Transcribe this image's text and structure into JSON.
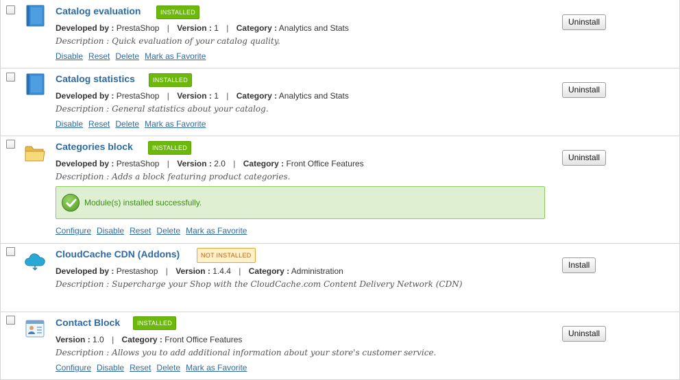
{
  "labels": {
    "developed_by": "Developed by :",
    "version": "Version :",
    "category": "Category :",
    "description": "Description :"
  },
  "colors": {
    "title": "#2d6aa3",
    "installed_badge": "#6cb80b",
    "not_installed_badge_bg": "#fff0c6",
    "not_installed_badge_text": "#c55f0f",
    "success_bg": "#dff0d2"
  },
  "modules": [
    {
      "name": "Catalog evaluation",
      "icon": "book-icon",
      "status": "INSTALLED",
      "developer": "PrestaShop",
      "version": "1",
      "category": "Analytics and Stats",
      "description": "Quick evaluation of your catalog quality.",
      "action": "Uninstall",
      "links": [
        "Disable",
        "Reset",
        "Delete",
        "Mark as Favorite"
      ]
    },
    {
      "name": "Catalog statistics",
      "icon": "book-icon",
      "status": "INSTALLED",
      "developer": "PrestaShop",
      "version": "1",
      "category": "Analytics and Stats",
      "description": "General statistics about your catalog.",
      "action": "Uninstall",
      "links": [
        "Disable",
        "Reset",
        "Delete",
        "Mark as Favorite"
      ]
    },
    {
      "name": "Categories block",
      "icon": "folder-icon",
      "status": "INSTALLED",
      "developer": "PrestaShop",
      "version": "2.0",
      "category": "Front Office Features",
      "description": "Adds a block featuring product categories.",
      "success_message": "Module(s) installed successfully.",
      "action": "Uninstall",
      "links": [
        "Configure",
        "Disable",
        "Reset",
        "Delete",
        "Mark as Favorite"
      ]
    },
    {
      "name": "CloudCache CDN (Addons)",
      "icon": "cloud-icon",
      "status": "NOT INSTALLED",
      "developer": "Prestashop",
      "version": "1.4.4",
      "category": "Administration",
      "description": "Supercharge your Shop with the CloudCache.com Content Delivery Network (CDN)",
      "action": "Install",
      "links": []
    },
    {
      "name": "Contact Block",
      "icon": "contact-card-icon",
      "status": "INSTALLED",
      "version": "1.0",
      "category": "Front Office Features",
      "description": "Allows you to add additional information about your store's customer service.",
      "action": "Uninstall",
      "links": [
        "Configure",
        "Disable",
        "Reset",
        "Delete",
        "Mark as Favorite"
      ]
    }
  ]
}
